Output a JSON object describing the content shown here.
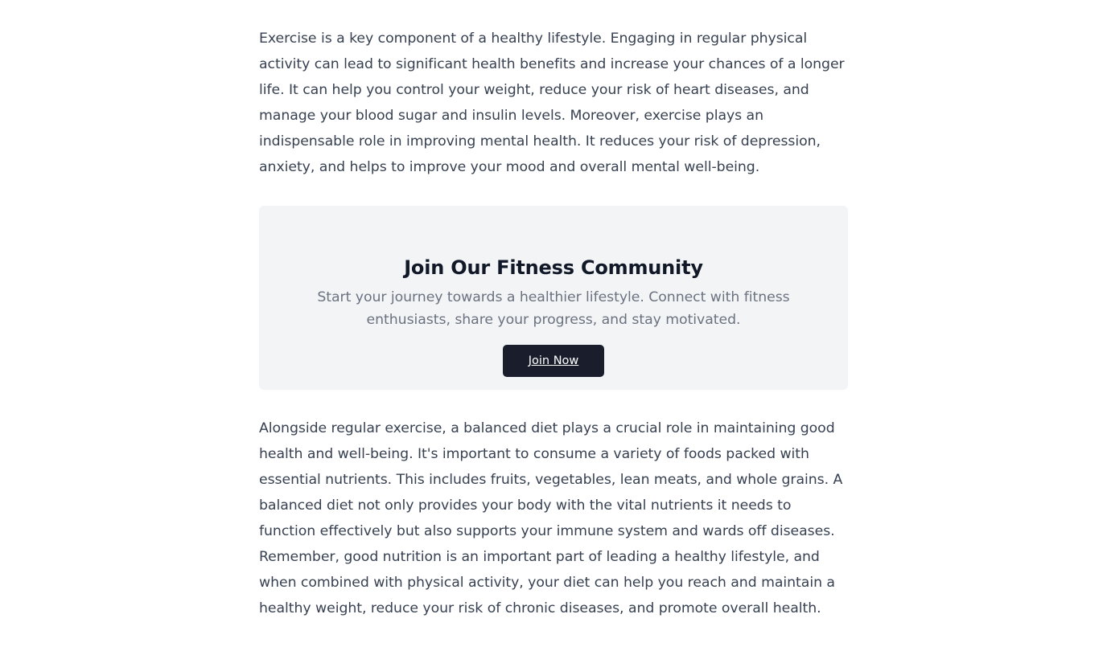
{
  "article": {
    "intro": "Exercise is a key component of a healthy lifestyle. Engaging in regular physical activity can lead to significant health benefits and increase your chances of a longer life. It can help you control your weight, reduce your risk of heart diseases, and manage your blood sugar and insulin levels. Moreover, exercise plays an indispensable role in improving mental health. It reduces your risk of depression, anxiety, and helps to improve your mood and overall mental well-being.",
    "diet": "Alongside regular exercise, a balanced diet plays a crucial role in maintaining good health and well-being. It's important to consume a variety of foods packed with essential nutrients. This includes fruits, vegetables, lean meats, and whole grains. A balanced diet not only provides your body with the vital nutrients it needs to function effectively but also supports your immune system and wards off diseases. Remember, good nutrition is an important part of leading a healthy lifestyle, and when combined with physical activity, your diet can help you reach and maintain a healthy weight, reduce your risk of chronic diseases, and promote overall health."
  },
  "cta": {
    "title": "Join Our Fitness Community",
    "subtitle": "Start your journey towards a healthier lifestyle. Connect with fitness enthusiasts, share your progress, and stay motivated.",
    "button_label": "Join Now"
  },
  "colors": {
    "text": "#374151",
    "title": "#111827",
    "muted": "#6b7280",
    "panel": "#f3f4f6",
    "button": "#1a1e2c"
  }
}
